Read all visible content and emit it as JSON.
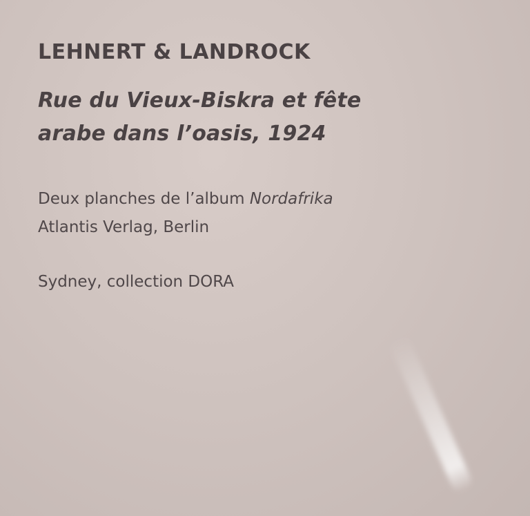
{
  "label": {
    "artist": "LEHNERT & LANDROCK",
    "title_line1": "Rue du Vieux-Biskra et fête",
    "title_line2": "arabe dans l’oasis, 1924",
    "description_prefix": "Deux planches de l’album ",
    "album_name": "Nordafrika",
    "publisher": "Atlantis Verlag, Berlin",
    "collection": "Sydney, collection DORA"
  }
}
